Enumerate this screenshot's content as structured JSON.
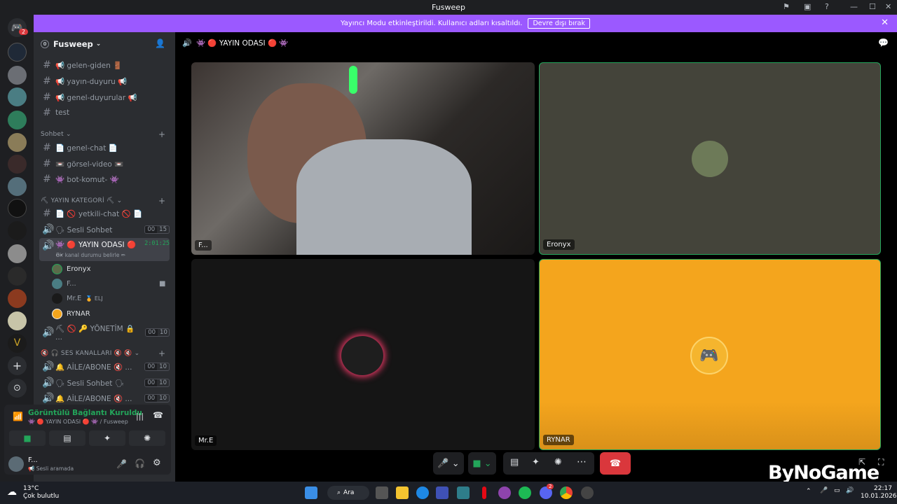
{
  "window": {
    "title": "Fusweep"
  },
  "banner": {
    "text": "Yayıncı Modu etkinleştirildi. Kullanıcı adları kısaltıldı.",
    "button": "Devre dışı bırak"
  },
  "rail": {
    "badge": "2"
  },
  "server": {
    "name": "Fusweep",
    "count": "0"
  },
  "channels": {
    "text1": [
      {
        "label": "📢 gelen-giden 🚪"
      },
      {
        "label": "📢 yayın-duyuru 📢"
      },
      {
        "label": "📢 genel-duyurular 📢"
      },
      {
        "label": "test"
      }
    ],
    "cat_sohbet": "Sohbet",
    "text2": [
      {
        "label": "📄 genel-chat 📄"
      },
      {
        "label": "📼 görsel-video 📼"
      },
      {
        "label": "👾 bot-komut- 👾"
      }
    ],
    "cat_yayin": "⛏ YAYIN KATEGORİ ⛏",
    "yetkili": "📄 🚫 yetkili-chat 🚫 📄",
    "sesli": {
      "label": "🗣 Sesli Sohbet",
      "a": "00",
      "b": "15"
    },
    "active": {
      "label": "👾 🔴 YAYIN ODASI 🔴 ...",
      "timer": "2:01:25",
      "status": "Bir kanal durumu belirle ✏"
    },
    "users": [
      {
        "name": "Eronyx",
        "extra": ""
      },
      {
        "name": "F...",
        "extra": ""
      },
      {
        "name": "Mr.E",
        "extra": "🏅 ELJ"
      },
      {
        "name": "RYNAR",
        "extra": ""
      }
    ],
    "yonetim": {
      "label": "⛏ 🚫 🔑 YÖNETİM 🔒 ...",
      "a": "00",
      "b": "10"
    },
    "cat_ses": "🔇 🎧 SES KANALLARI 🔇 🔇",
    "voice2": [
      {
        "label": "🔔 AİLE/ABONE 🔇 ...",
        "a": "00",
        "b": "10"
      },
      {
        "label": "🗣 Sesli Sohbet 🗣",
        "a": "00",
        "b": "10"
      },
      {
        "label": "🔔 AİLE/ABONE 🔇 ...",
        "a": "00",
        "b": "10"
      }
    ]
  },
  "voicepanel": {
    "status": "Görüntülü Bağlantı Kuruldu",
    "channel": "👾 🔴 YAYIN ODASI 🔴 👾 / Fusweep"
  },
  "me": {
    "name": "F...",
    "status": "📢 Sesli aramada"
  },
  "stage": {
    "header": "👾 🔴 YAYIN ODASI 🔴 👾",
    "tiles": [
      {
        "name": "F..."
      },
      {
        "name": "Eronyx"
      },
      {
        "name": "Mr.E"
      },
      {
        "name": "RYNAR"
      }
    ]
  },
  "watermark": "ByNoGame",
  "taskbar": {
    "temp": "13°C",
    "weather": "Çok bulutlu",
    "search": "Ara",
    "time": "22:17",
    "date": "10.01.2026",
    "discord_badge": "2"
  },
  "colors": {
    "brand": "#9b59ff",
    "green": "#23a55a",
    "danger": "#da373c",
    "ryanr_bg": "#f4a51d"
  }
}
